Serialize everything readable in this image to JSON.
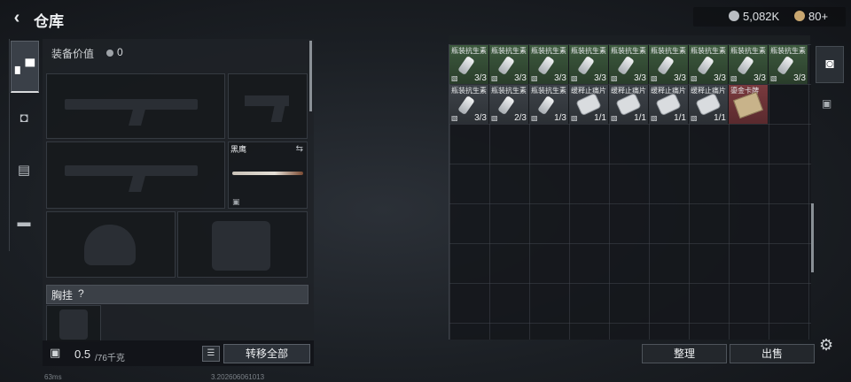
{
  "header": {
    "back_icon": "back-arrow-icon",
    "title": "仓库"
  },
  "currency": {
    "silver": "5,082K",
    "gold": "80+",
    "silver_color": "#b9bdc2",
    "gold_color": "#c9a770"
  },
  "left_nav": {
    "items": [
      "weapon-icon",
      "backpack-icon",
      "clipboard-icon",
      "toolbox-icon"
    ]
  },
  "loadout": {
    "equip_value_label": "装备价值",
    "equip_value": "0",
    "melee_name": "黑鹰",
    "chest_label": "胸挂",
    "chest_q": "?",
    "weight_value": "0.5",
    "weight_max": "/76千克",
    "transfer_all": "转移全部"
  },
  "storage": {
    "items": [
      {
        "name": "瓶装抗生素",
        "count": "3/3",
        "kind": "bottle",
        "rarity": "green"
      },
      {
        "name": "瓶装抗生素",
        "count": "3/3",
        "kind": "bottle",
        "rarity": "green"
      },
      {
        "name": "瓶装抗生素",
        "count": "3/3",
        "kind": "bottle",
        "rarity": "green"
      },
      {
        "name": "瓶装抗生素",
        "count": "3/3",
        "kind": "bottle",
        "rarity": "green"
      },
      {
        "name": "瓶装抗生素",
        "count": "3/3",
        "kind": "bottle",
        "rarity": "green"
      },
      {
        "name": "瓶装抗生素",
        "count": "3/3",
        "kind": "bottle",
        "rarity": "green"
      },
      {
        "name": "瓶装抗生素",
        "count": "3/3",
        "kind": "bottle",
        "rarity": "green"
      },
      {
        "name": "瓶装抗生素",
        "count": "3/3",
        "kind": "bottle",
        "rarity": "green"
      },
      {
        "name": "瓶装抗生素",
        "count": "3/3",
        "kind": "bottle",
        "rarity": "green"
      },
      {
        "name": "瓶装抗生素",
        "count": "3/3",
        "kind": "bottle",
        "rarity": "grey"
      },
      {
        "name": "瓶装抗生素",
        "count": "2/3",
        "kind": "bottle",
        "rarity": "grey"
      },
      {
        "name": "瓶装抗生素",
        "count": "1/3",
        "kind": "bottle",
        "rarity": "grey"
      },
      {
        "name": "缓释止痛片",
        "count": "1/1",
        "kind": "pill",
        "rarity": "grey"
      },
      {
        "name": "缓释止痛片",
        "count": "1/1",
        "kind": "pill",
        "rarity": "grey"
      },
      {
        "name": "缓释止痛片",
        "count": "1/1",
        "kind": "pill",
        "rarity": "grey"
      },
      {
        "name": "缓释止痛片",
        "count": "1/1",
        "kind": "pill",
        "rarity": "grey"
      },
      {
        "name": "鎏金卡牌",
        "count": "",
        "kind": "card",
        "rarity": "red"
      }
    ],
    "sort_label": "整理",
    "sell_label": "出售"
  },
  "status": {
    "ping": "63ms",
    "version": "3.202606061013"
  }
}
